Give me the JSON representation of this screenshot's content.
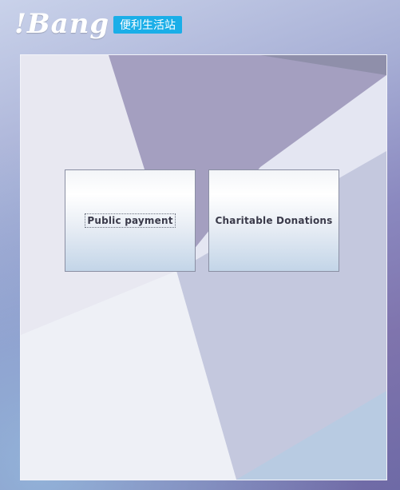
{
  "header": {
    "logo": "!Bang",
    "badge": "便利生活站"
  },
  "services": [
    {
      "label": "Public payment"
    },
    {
      "label": "Charitable Donations"
    }
  ],
  "colors": {
    "badge_bg": "#1aaee8",
    "card_border": "#8a8fa3",
    "panel_light": "#e4e6f2"
  }
}
